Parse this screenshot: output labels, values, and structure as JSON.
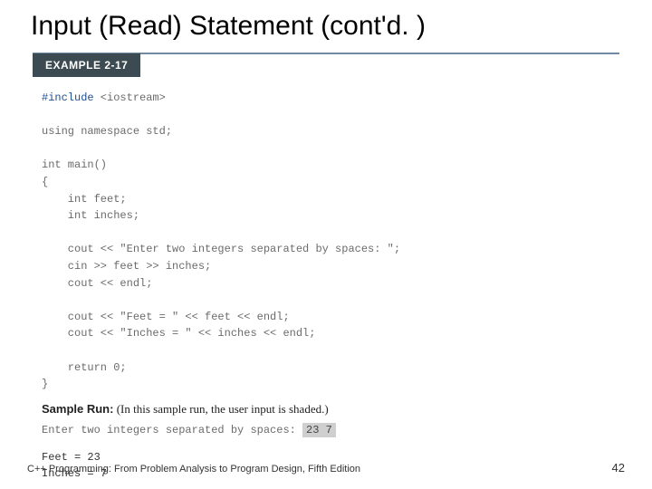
{
  "title": "Input (Read) Statement (cont'd. )",
  "example_label": "EXAMPLE 2-17",
  "code": {
    "include": "#include",
    "iostream": " <iostream>",
    "using": "using namespace ",
    "std": "std;",
    "int_main": "int main()",
    "open": "{",
    "decl1": "    int feet;",
    "decl2": "    int inches;",
    "cout1": "    cout << \"Enter two integers separated by spaces: \";",
    "cin": "    cin >> feet >> inches;",
    "endl": "    cout << endl;",
    "cout2": "    cout << \"Feet = \" << feet << endl;",
    "cout3": "    cout << \"Inches = \" << inches << endl;",
    "ret": "    return 0;",
    "close": "}"
  },
  "sample_run": {
    "label_bold": "Sample Run:",
    "label_note": " (In this sample run, the user input is shaded.)",
    "prompt": "Enter two integers separated by spaces: ",
    "input": "23 7",
    "out1": "Feet = 23",
    "out2": "Inches = 7"
  },
  "footer": {
    "text": "C++ Programming: From Problem Analysis to Program Design, Fifth Edition",
    "page": "42"
  }
}
